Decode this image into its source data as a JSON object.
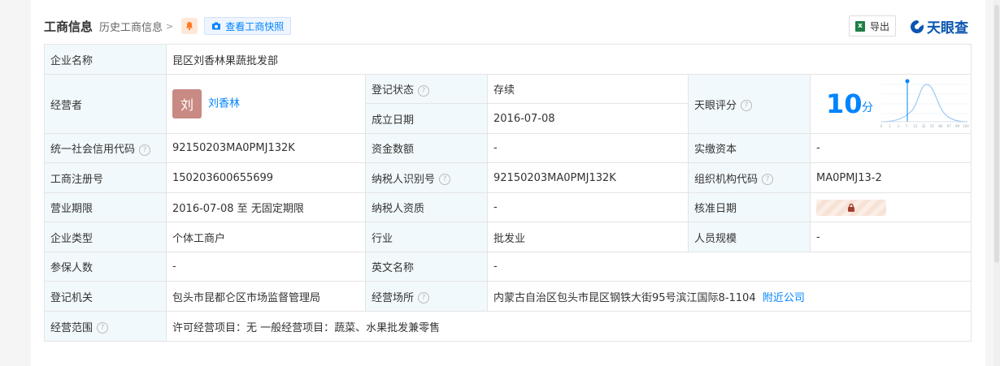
{
  "header": {
    "title": "工商信息",
    "history": "历史工商信息",
    "snapshot": "查看工商快照",
    "export": "导出",
    "logo": "天眼查"
  },
  "rows": {
    "company_name_label": "企业名称",
    "company_name": "昆区刘香林果蔬批发部",
    "operator_label": "经营者",
    "operator_avatar": "刘",
    "operator_name": "刘香林",
    "status_label": "登记状态",
    "status": "存续",
    "found_date_label": "成立日期",
    "found_date": "2016-07-08",
    "score_label": "天眼评分",
    "score": "10",
    "score_unit": "分",
    "credit_code_label": "统一社会信用代码",
    "credit_code": "92150203MA0PMJ132K",
    "capital_label": "资金数额",
    "capital": "-",
    "paid_capital_label": "实缴资本",
    "paid_capital": "-",
    "reg_no_label": "工商注册号",
    "reg_no": "150203600655699",
    "tax_id_label": "纳税人识别号",
    "tax_id": "92150203MA0PMJ132K",
    "org_code_label": "组织机构代码",
    "org_code": "MA0PMJ13-2",
    "term_label": "营业期限",
    "term": "2016-07-08 至 无固定期限",
    "tax_qual_label": "纳税人资质",
    "tax_qual": "-",
    "approve_label": "核准日期",
    "type_label": "企业类型",
    "type": "个体工商户",
    "industry_label": "行业",
    "industry": "批发业",
    "staff_label": "人员规模",
    "staff": "-",
    "insured_label": "参保人数",
    "insured": "-",
    "en_name_label": "英文名称",
    "en_name": "-",
    "authority_label": "登记机关",
    "authority": "包头市昆都仑区市场监督管理局",
    "address_label": "经营场所",
    "address": "内蒙古自治区包头市昆区钢铁大街95号滨江国际8-1104",
    "nearby": "附近公司",
    "scope_label": "经营范围",
    "scope": "许可经营项目：无 一般经营项目：蔬菜、水果批发兼零售"
  },
  "score_axis": [
    "0",
    "1",
    "3",
    "7",
    "15",
    "32",
    "55",
    "80",
    "97",
    "99",
    "100"
  ],
  "colors": {
    "accent": "#0084ff",
    "status_green": "#009944",
    "label_bg": "#f2f9fc"
  }
}
